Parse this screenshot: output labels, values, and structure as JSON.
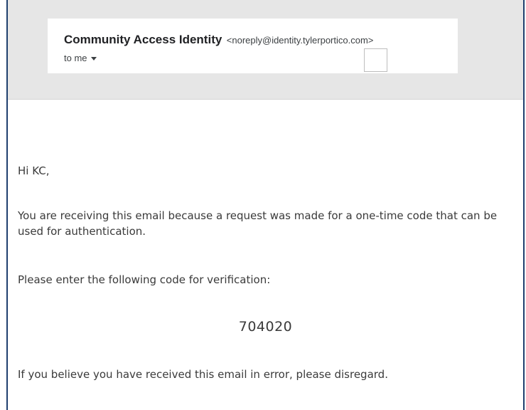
{
  "email": {
    "sender_name": "Community Access Identity",
    "sender_email": "<noreply@identity.tylerportico.com>",
    "recipient": "to me",
    "greeting": "Hi KC,",
    "paragraph_1": "You are receiving this email because a request was made for a one-time code that can be used for authentication.",
    "paragraph_2": "Please enter the following code for verification:",
    "code": "704020",
    "paragraph_3": "If you believe you have received this email in error, please disregard."
  }
}
